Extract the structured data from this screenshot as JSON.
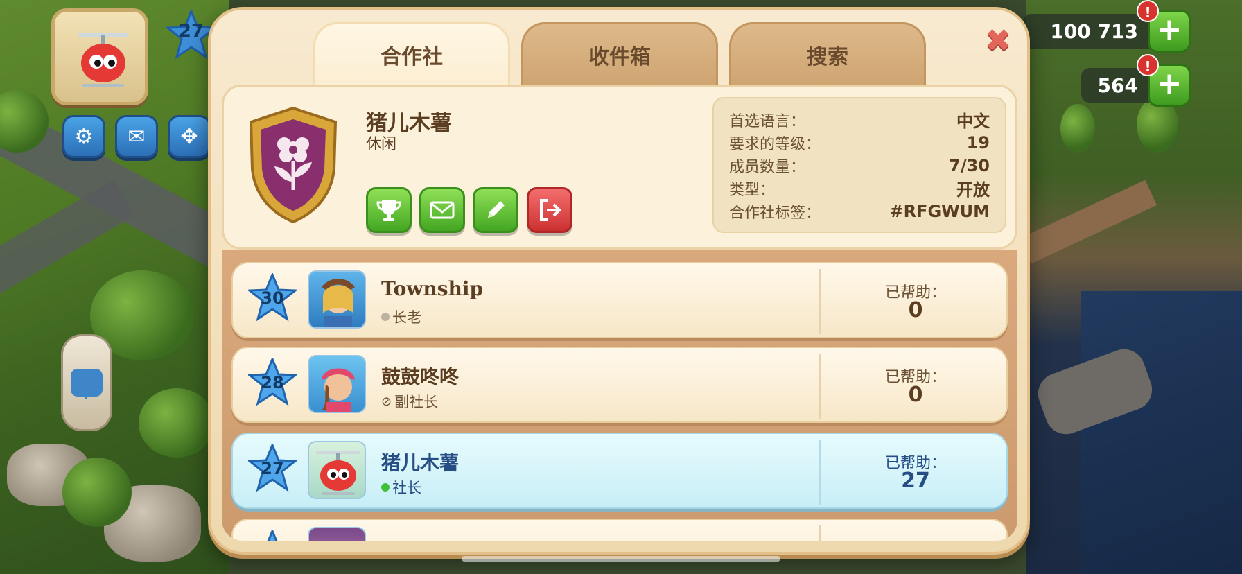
{
  "hud": {
    "player_level": "27",
    "coins": "100 713",
    "cash": "564",
    "alert_mark": "!",
    "plus_symbol": "+"
  },
  "dialog": {
    "close_symbol": "✖",
    "tabs": [
      {
        "label": "合作社",
        "active": true
      },
      {
        "label": "收件箱",
        "active": false
      },
      {
        "label": "搜索",
        "active": false
      }
    ]
  },
  "club": {
    "name": "猪儿木薯",
    "type_tag": "休闲",
    "badge_icon": "flower-shield",
    "actions": [
      {
        "name": "trophy",
        "color": "green"
      },
      {
        "name": "mail",
        "color": "green"
      },
      {
        "name": "edit",
        "color": "green"
      },
      {
        "name": "leave",
        "color": "red"
      }
    ],
    "stats": [
      {
        "label": "首选语言：",
        "value": "中文"
      },
      {
        "label": "要求的等级：",
        "value": "19"
      },
      {
        "label": "成员数量：",
        "value": "7/30"
      },
      {
        "label": "类型：",
        "value": "开放"
      },
      {
        "label": "合作社标签：",
        "value": "#RFGWUM"
      }
    ]
  },
  "members": [
    {
      "level": "30",
      "name": "Township",
      "role": "长老",
      "role_icon": "grey-dot",
      "helped_label": "已帮助：",
      "helped": "0",
      "self": false
    },
    {
      "level": "28",
      "name": "鼓鼓咚咚",
      "role": "副社长",
      "role_icon": "no-symbol",
      "helped_label": "已帮助：",
      "helped": "0",
      "self": false
    },
    {
      "level": "27",
      "name": "猪儿木薯",
      "role": "社长",
      "role_icon": "green-dot",
      "helped_label": "已帮助：",
      "helped": "27",
      "self": true
    }
  ],
  "colors": {
    "accent_green": "#43a622",
    "accent_red": "#cc3131",
    "self_row": "#c8eef7",
    "text_brown": "#5b3d22",
    "text_blue": "#264e84"
  }
}
